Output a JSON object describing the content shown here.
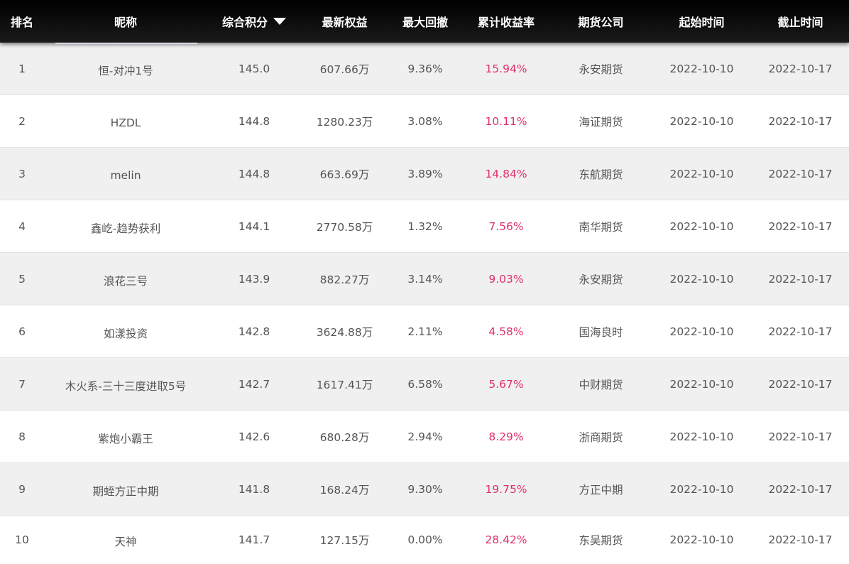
{
  "header": {
    "rank": "排名",
    "name": "昵称",
    "score": "综合积分",
    "equity": "最新权益",
    "drawdown": "最大回撤",
    "return": "累计收益率",
    "company": "期货公司",
    "start": "起始时间",
    "end": "截止时间",
    "sort_icon": "caret-down-icon"
  },
  "colors": {
    "header_bg": "#0a0a0a",
    "return_text": "#e0306a",
    "odd_row": "#f0f0f0",
    "even_row": "#ffffff",
    "body_text": "#555555"
  },
  "rows": [
    {
      "rank": "1",
      "name": "恒-对冲1号",
      "score": "145.0",
      "equity": "607.66万",
      "drawdown": "9.36%",
      "return": "15.94%",
      "company": "永安期货",
      "start": "2022-10-10",
      "end": "2022-10-17"
    },
    {
      "rank": "2",
      "name": "HZDL",
      "score": "144.8",
      "equity": "1280.23万",
      "drawdown": "3.08%",
      "return": "10.11%",
      "company": "海证期货",
      "start": "2022-10-10",
      "end": "2022-10-17"
    },
    {
      "rank": "3",
      "name": "melin",
      "score": "144.8",
      "equity": "663.69万",
      "drawdown": "3.89%",
      "return": "14.84%",
      "company": "东航期货",
      "start": "2022-10-10",
      "end": "2022-10-17"
    },
    {
      "rank": "4",
      "name": "鑫屹-趋势获利",
      "score": "144.1",
      "equity": "2770.58万",
      "drawdown": "1.32%",
      "return": "7.56%",
      "company": "南华期货",
      "start": "2022-10-10",
      "end": "2022-10-17"
    },
    {
      "rank": "5",
      "name": "浪花三号",
      "score": "143.9",
      "equity": "882.27万",
      "drawdown": "3.14%",
      "return": "9.03%",
      "company": "永安期货",
      "start": "2022-10-10",
      "end": "2022-10-17"
    },
    {
      "rank": "6",
      "name": "如漾投资",
      "score": "142.8",
      "equity": "3624.88万",
      "drawdown": "2.11%",
      "return": "4.58%",
      "company": "国海良时",
      "start": "2022-10-10",
      "end": "2022-10-17"
    },
    {
      "rank": "7",
      "name": "木火系-三十三度进取5号",
      "score": "142.7",
      "equity": "1617.41万",
      "drawdown": "6.58%",
      "return": "5.67%",
      "company": "中财期货",
      "start": "2022-10-10",
      "end": "2022-10-17"
    },
    {
      "rank": "8",
      "name": "紫炮小霸王",
      "score": "142.6",
      "equity": "680.28万",
      "drawdown": "2.94%",
      "return": "8.29%",
      "company": "浙商期货",
      "start": "2022-10-10",
      "end": "2022-10-17"
    },
    {
      "rank": "9",
      "name": "期蛭方正中期",
      "score": "141.8",
      "equity": "168.24万",
      "drawdown": "9.30%",
      "return": "19.75%",
      "company": "方正中期",
      "start": "2022-10-10",
      "end": "2022-10-17"
    },
    {
      "rank": "10",
      "name": "天神",
      "score": "141.7",
      "equity": "127.15万",
      "drawdown": "0.00%",
      "return": "28.42%",
      "company": "东吴期货",
      "start": "2022-10-10",
      "end": "2022-10-17"
    }
  ]
}
